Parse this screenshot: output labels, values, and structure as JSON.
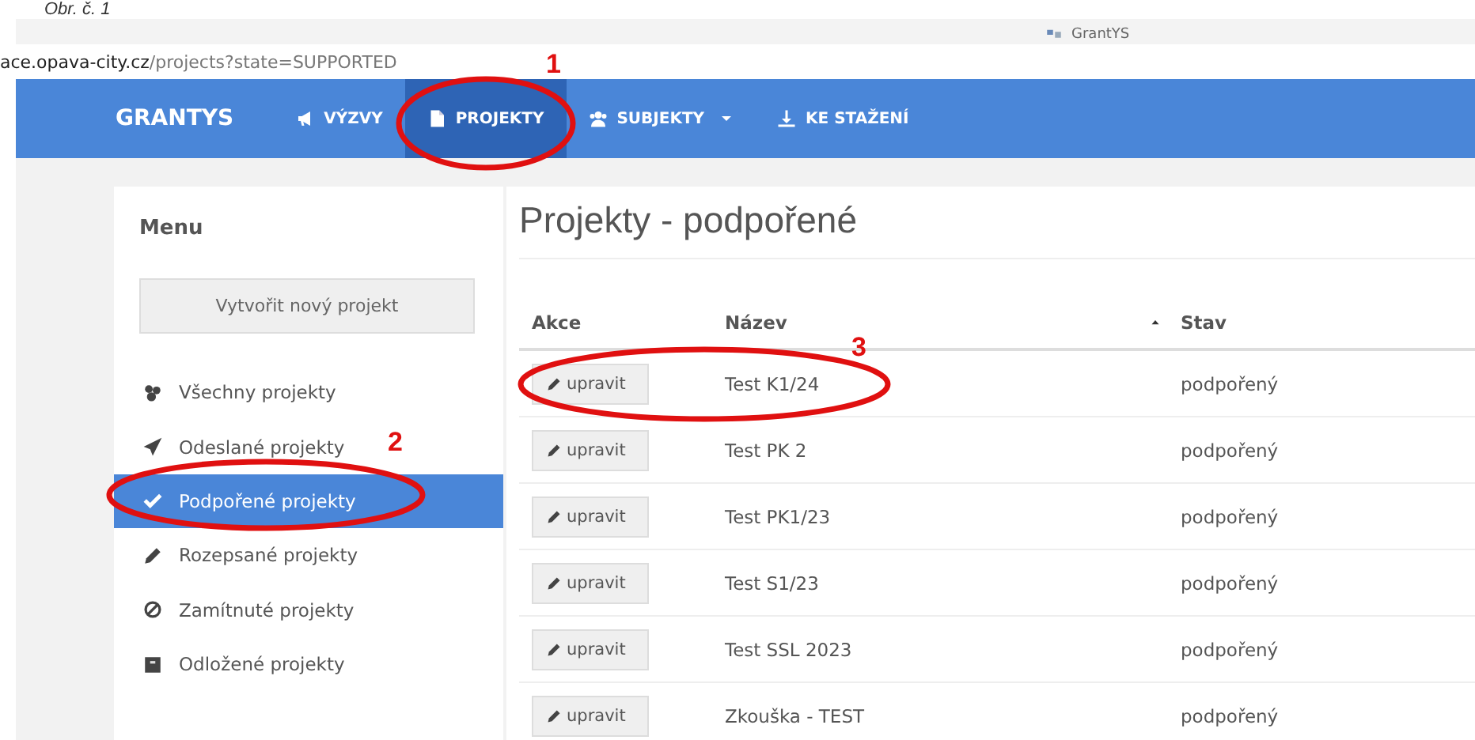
{
  "caption": "Obr. č. 1",
  "browser_tab": {
    "title": "GrantYS"
  },
  "address_bar": {
    "host": "ace.opava-city.cz",
    "path": "/projects?state=SUPPORTED"
  },
  "navbar": {
    "brand": "GRANTYS",
    "items": [
      {
        "label": "VÝZVY",
        "selected": false,
        "dropdown": false
      },
      {
        "label": "PROJEKTY",
        "selected": true,
        "dropdown": false
      },
      {
        "label": "SUBJEKTY",
        "selected": false,
        "dropdown": true
      },
      {
        "label": "KE STAŽENÍ",
        "selected": false,
        "dropdown": false
      }
    ]
  },
  "sidebar": {
    "title": "Menu",
    "create_button": "Vytvořit nový projekt",
    "items": [
      {
        "label": "Všechny projekty",
        "selected": false
      },
      {
        "label": "Odeslané projekty",
        "selected": false
      },
      {
        "label": "Podpořené projekty",
        "selected": true
      },
      {
        "label": "Rozepsané projekty",
        "selected": false
      },
      {
        "label": "Zamítnuté projekty",
        "selected": false
      },
      {
        "label": "Odložené projekty",
        "selected": false
      }
    ]
  },
  "heading": "Projekty - podpořené",
  "table": {
    "columns": [
      "Akce",
      "Název",
      "Stav"
    ],
    "rows": [
      {
        "action": "upravit",
        "name": "Test K1/24",
        "state": "podpořený"
      },
      {
        "action": "upravit",
        "name": "Test PK 2",
        "state": "podpořený"
      },
      {
        "action": "upravit",
        "name": "Test PK1/23",
        "state": "podpořený"
      },
      {
        "action": "upravit",
        "name": "Test S1/23",
        "state": "podpořený"
      },
      {
        "action": "upravit",
        "name": "Test SSL 2023",
        "state": "podpořený"
      },
      {
        "action": "upravit",
        "name": "Zkouška - TEST",
        "state": "podpořený"
      }
    ]
  },
  "annotations": [
    {
      "label": "1"
    },
    {
      "label": "2"
    },
    {
      "label": "3"
    }
  ]
}
